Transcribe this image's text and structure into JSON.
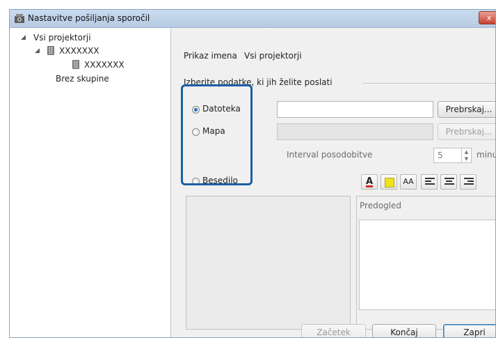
{
  "window": {
    "title": "Nastavitve pošiljanja sporočil",
    "close_symbol": "x"
  },
  "tree": {
    "root_label": "Vsi projektorji",
    "group_label": "XXXXXXX",
    "projector_label": "XXXXXXX",
    "no_group_label": "Brez skupine"
  },
  "main": {
    "display_name_label": "Prikaz imena",
    "display_name_value": "Vsi projektorji",
    "select_data_label": "Izberite podatke, ki jih želite poslati",
    "file_option": "Datoteka",
    "folder_option": "Mapa",
    "text_option": "Besedilo",
    "selected_option": "Datoteka",
    "browse_file_label": "Prebrskaj...",
    "browse_folder_label": "Prebrskaj...",
    "update_interval_label": "Interval posodobitve",
    "update_interval_value": "5",
    "update_interval_unit": "minut",
    "preview_label": "Predogled"
  },
  "formatting": {
    "font_size_symbol": "AA",
    "text_color": "#d12a2a",
    "fill_color": "#f0e21e"
  },
  "footer": {
    "start_label": "Začetek",
    "finish_label": "Končaj",
    "close_label": "Zapri"
  },
  "highlight_color": "#1d5fa4"
}
